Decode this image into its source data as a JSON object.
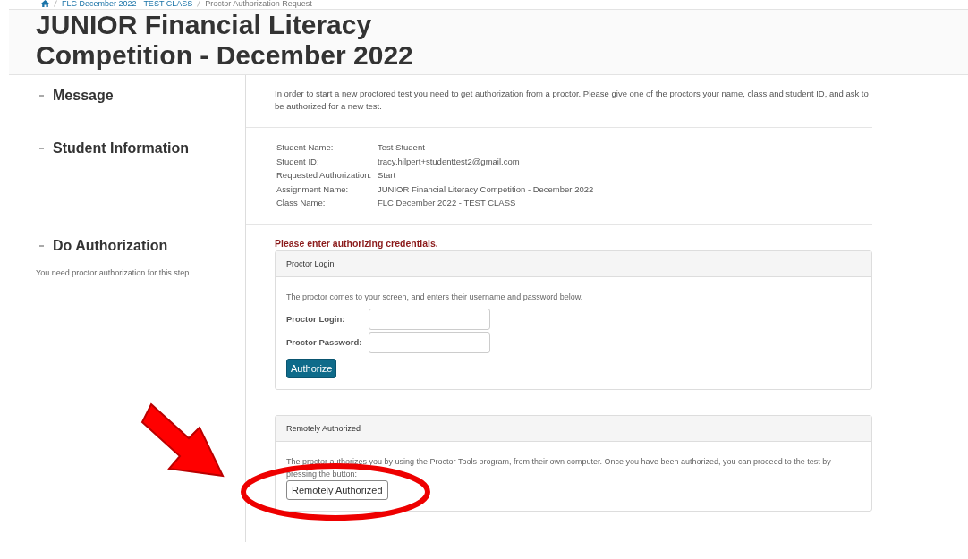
{
  "breadcrumb": {
    "items": [
      "FLC December 2022 - TEST CLASS",
      "Proctor Authorization Request"
    ]
  },
  "page_title": "JUNIOR Financial Literacy Competition - December 2022",
  "sections": [
    {
      "kind": "message",
      "title": "Message",
      "text": "In order to start a new proctored test you need to get authorization from a proctor. Please give one of the proctors your name, class and student ID, and ask to be authorized for a new test."
    },
    {
      "kind": "info",
      "title": "Student Information",
      "fields": [
        {
          "label": "Student Name:",
          "value": "Test Student"
        },
        {
          "label": "Student ID:",
          "value": "tracy.hilpert+studenttest2@gmail.com"
        },
        {
          "label": "Requested Authorization:",
          "value": "Start"
        },
        {
          "label": "Assignment Name:",
          "value": "JUNIOR Financial Literacy Competition - December 2022"
        },
        {
          "label": "Class Name:",
          "value": "FLC December 2022 - TEST CLASS"
        }
      ]
    },
    {
      "kind": "auth",
      "title": "Do Authorization",
      "note": "You need proctor authorization for this step.",
      "error": "Please enter authorizing credentials.",
      "login_panel": {
        "heading": "Proctor Login",
        "text": "The proctor comes to your screen, and enters their username and password below.",
        "login_label": "Proctor Login:",
        "password_label": "Proctor Password:",
        "button": "Authorize"
      },
      "remote_panel": {
        "heading": "Remotely Authorized",
        "text": "The proctor authorizes you by using the Proctor Tools program, from their own computer. Once you have been authorized, you can proceed to the test by pressing the button:",
        "button": "Remotely Authorized"
      }
    }
  ]
}
